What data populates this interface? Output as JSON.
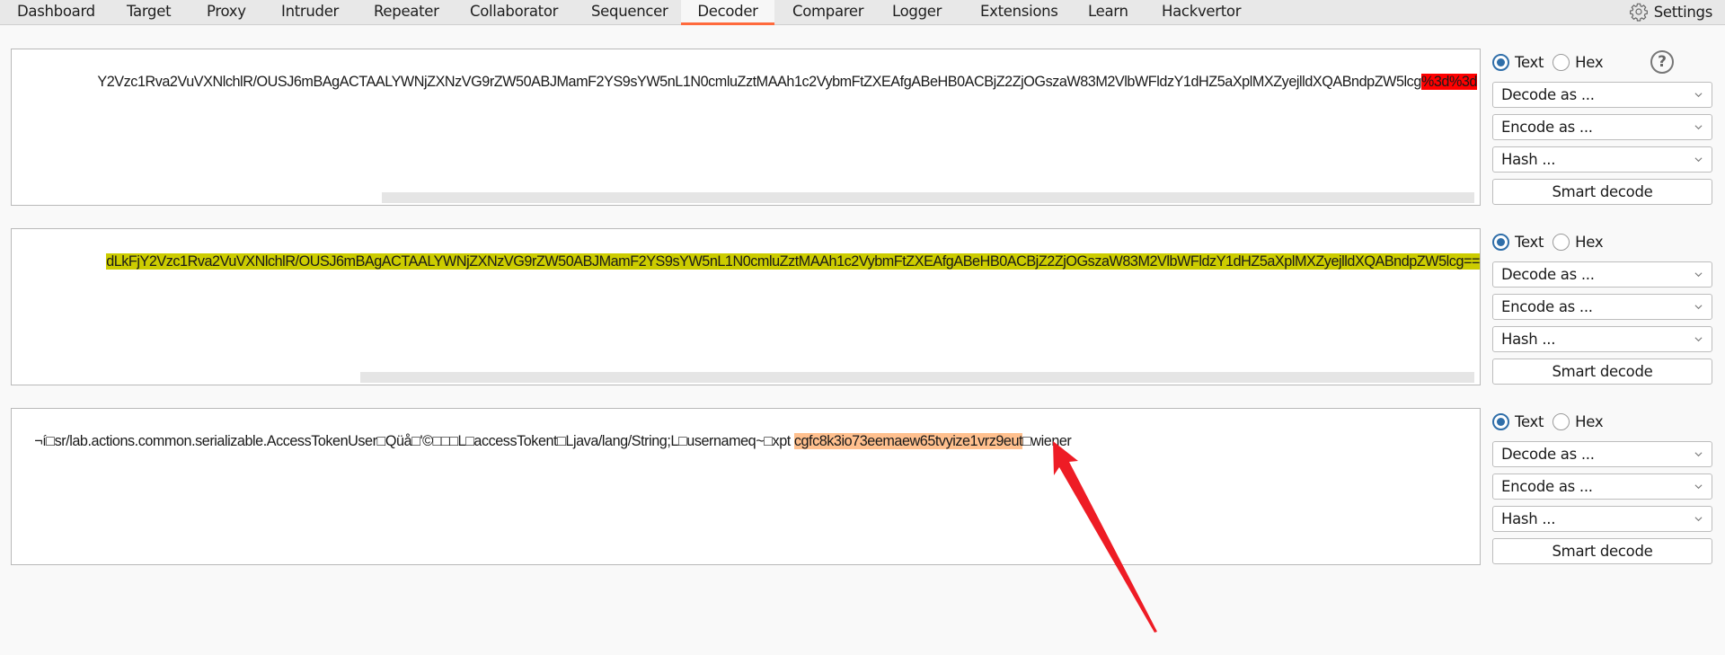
{
  "tabs": [
    {
      "label": "Dashboard",
      "active": false
    },
    {
      "label": "Target",
      "active": false
    },
    {
      "label": "Proxy",
      "active": false
    },
    {
      "label": "Intruder",
      "active": false
    },
    {
      "label": "Repeater",
      "active": false
    },
    {
      "label": "Collaborator",
      "active": false
    },
    {
      "label": "Sequencer",
      "active": false
    },
    {
      "label": "Decoder",
      "active": true
    },
    {
      "label": "Comparer",
      "active": false
    },
    {
      "label": "Logger",
      "active": false
    },
    {
      "label": "Extensions",
      "active": false
    },
    {
      "label": "Learn",
      "active": false
    },
    {
      "label": "Hackvertor",
      "active": false
    }
  ],
  "settings_label": "Settings",
  "colors": {
    "active_tab_underline": "#ff6a3d",
    "highlight_red": "#ff0000",
    "highlight_yellow": "#cccc00",
    "highlight_orange": "#ffc08e",
    "radio_accent": "#2f6ea9",
    "annotation_arrow": "#ee1c25"
  },
  "panels": [
    {
      "text_before": "Y2Vzc1Rva2VuVXNlchlR/OUSJ6mBAgACTAALYWNjZXNzVG9rZW50ABJMamF2YS9sYW5nL1N0cmluZztMAAh1c2VybmFtZXEAfgABeHB0ACBjZ2ZjOGszaW83M2VlbWFldzY1dHZ5aXplMXZyejlldXQABndpZW5lcg",
      "highlight": "%3d%3d",
      "text_after": "",
      "highlight_color": "red",
      "mode": "Text",
      "mode_options": [
        "Text",
        "Hex"
      ],
      "decode_label": "Decode as ...",
      "encode_label": "Encode as ...",
      "hash_label": "Hash ...",
      "smart_decode_label": "Smart decode",
      "show_help": true
    },
    {
      "text_before": "",
      "highlight": "dLkFjY2Vzc1Rva2VuVXNlchlR/OUSJ6mBAgACTAALYWNjZXNzVG9rZW50ABJMamF2YS9sYW5nL1N0cmluZztMAAh1c2VybmFtZXEAfgABeHB0ACBjZ2ZjOGszaW83M2VlbWFldzY1dHZ5aXplMXZyejlldXQABndpZW5lcg==",
      "text_after": "",
      "highlight_color": "yellow",
      "mode": "Text",
      "mode_options": [
        "Text",
        "Hex"
      ],
      "decode_label": "Decode as ...",
      "encode_label": "Encode as ...",
      "hash_label": "Hash ...",
      "smart_decode_label": "Smart decode",
      "show_help": false
    },
    {
      "text_before": "¬í□sr/lab.actions.common.serializable.AccessTokenUser□Qüå□'©□□□L□accessTokent□Ljava/lang/String;L□usernameq~□xpt ",
      "highlight": "cgfc8k3io73eemaew65tvyize1vrz9eut",
      "text_after": "□wiener",
      "highlight_color": "orange",
      "mode": "Text",
      "mode_options": [
        "Text",
        "Hex"
      ],
      "decode_label": "Decode as ...",
      "encode_label": "Encode as ...",
      "hash_label": "Hash ...",
      "smart_decode_label": "Smart decode",
      "show_help": false
    }
  ]
}
